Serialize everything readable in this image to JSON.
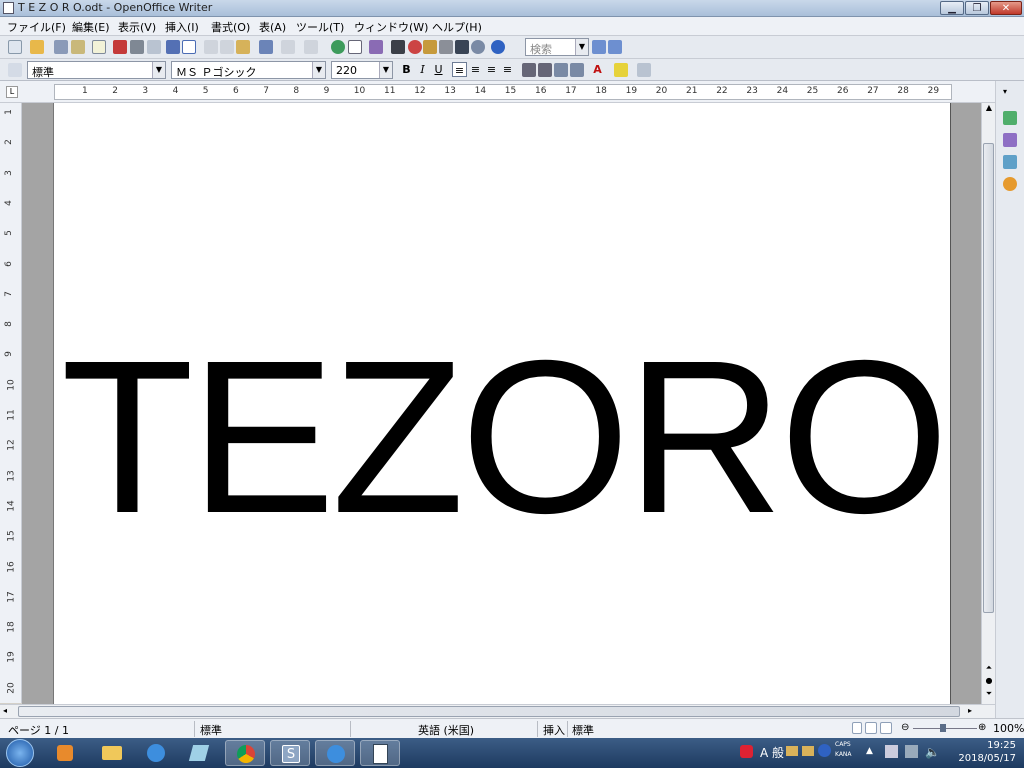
{
  "window": {
    "title": "T E Z O R O.odt - OpenOffice Writer"
  },
  "menu": [
    "ファイル(F)",
    "編集(E)",
    "表示(V)",
    "挿入(I)",
    "書式(O)",
    "表(A)",
    "ツール(T)",
    "ウィンドウ(W)",
    "ヘルプ(H)"
  ],
  "toolbar": {
    "search_placeholder": "検索"
  },
  "format": {
    "style": "標準",
    "font": "ＭＳ Ｐゴシック",
    "size": "220"
  },
  "ruler": {
    "h": [
      "1",
      "2",
      "3",
      "4",
      "5",
      "6",
      "7",
      "8",
      "9",
      "10",
      "11",
      "12",
      "13",
      "14",
      "15",
      "16",
      "17",
      "18",
      "19",
      "20",
      "21",
      "22",
      "23",
      "24",
      "25",
      "26",
      "27",
      "28",
      "29"
    ],
    "v": [
      "1",
      "2",
      "3",
      "4",
      "5",
      "6",
      "7",
      "8",
      "9",
      "10",
      "11",
      "12",
      "13",
      "14",
      "15",
      "16",
      "17",
      "18",
      "19",
      "20"
    ]
  },
  "document": {
    "text": "TEZORO"
  },
  "status": {
    "page": "ページ 1 / 1",
    "style": "標準",
    "language": "英語 (米国)",
    "mode": "挿入",
    "selection": "標準",
    "zoom": "100%"
  },
  "tray": {
    "ime": "A 般",
    "caps": "CAPS",
    "kana": "KANA"
  },
  "clock": {
    "time": "19:25",
    "date": "2018/05/17"
  }
}
